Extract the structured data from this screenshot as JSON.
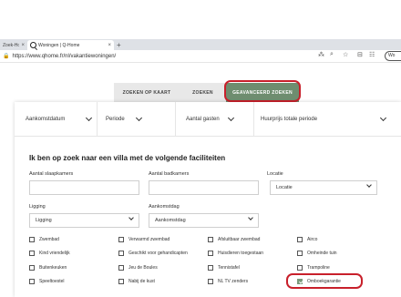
{
  "browser": {
    "tabs": [
      {
        "title": "Zoek-Hoo",
        "active": false
      },
      {
        "title": "Woningen | Q-Home",
        "active": true
      }
    ],
    "new_tab": "+",
    "close": "×",
    "url": "https://www.qhome.fr/nl/vakantiewoningen/",
    "profile_label": "Wo"
  },
  "search_tabs": [
    {
      "label": "ZOEKEN OP KAART",
      "active": false
    },
    {
      "label": "ZOEKEN",
      "active": false
    },
    {
      "label": "GEAVANCEERD ZOEKEN",
      "active": true
    }
  ],
  "filters": {
    "arrival": "Aankomstdatum",
    "period": "Periode",
    "guests": "Aantal gasten",
    "price": "Huurprijs totale periode"
  },
  "form": {
    "heading": "Ik ben op zoek naar een villa met de volgende faciliteiten",
    "bedrooms_label": "Aantal slaapkamers",
    "bathrooms_label": "Aantal badkamers",
    "location_label": "Locatie",
    "location_value": "Locatie",
    "situation_label": "Ligging",
    "situation_value": "Ligging",
    "arrival_day_label": "Aankomstdag",
    "arrival_day_value": "Aankomstdag"
  },
  "facilities": [
    {
      "label": "Zwembad",
      "checked": false
    },
    {
      "label": "Verwarmd zwembad",
      "checked": false
    },
    {
      "label": "Afsluitbaar zwembad",
      "checked": false
    },
    {
      "label": "Airco",
      "checked": false
    },
    {
      "label": "Kind vriendelijk",
      "checked": false
    },
    {
      "label": "Geschikt voor gehandicapten",
      "checked": false
    },
    {
      "label": "Huisdieren toegestaan",
      "checked": false
    },
    {
      "label": "Omheinde tuin",
      "checked": false
    },
    {
      "label": "Buitenkeuken",
      "checked": false
    },
    {
      "label": "Jeu de Boules",
      "checked": false
    },
    {
      "label": "Tennistafel",
      "checked": false
    },
    {
      "label": "Trampoline",
      "checked": false
    },
    {
      "label": "Speeltoestel",
      "checked": false
    },
    {
      "label": "Nabij de kust",
      "checked": false
    },
    {
      "label": "NL TV zenders",
      "checked": false
    },
    {
      "label": "Omboekgarantie",
      "checked": true
    }
  ],
  "colors": {
    "accent": "#6e8d6f",
    "highlight": "#c8202b"
  }
}
